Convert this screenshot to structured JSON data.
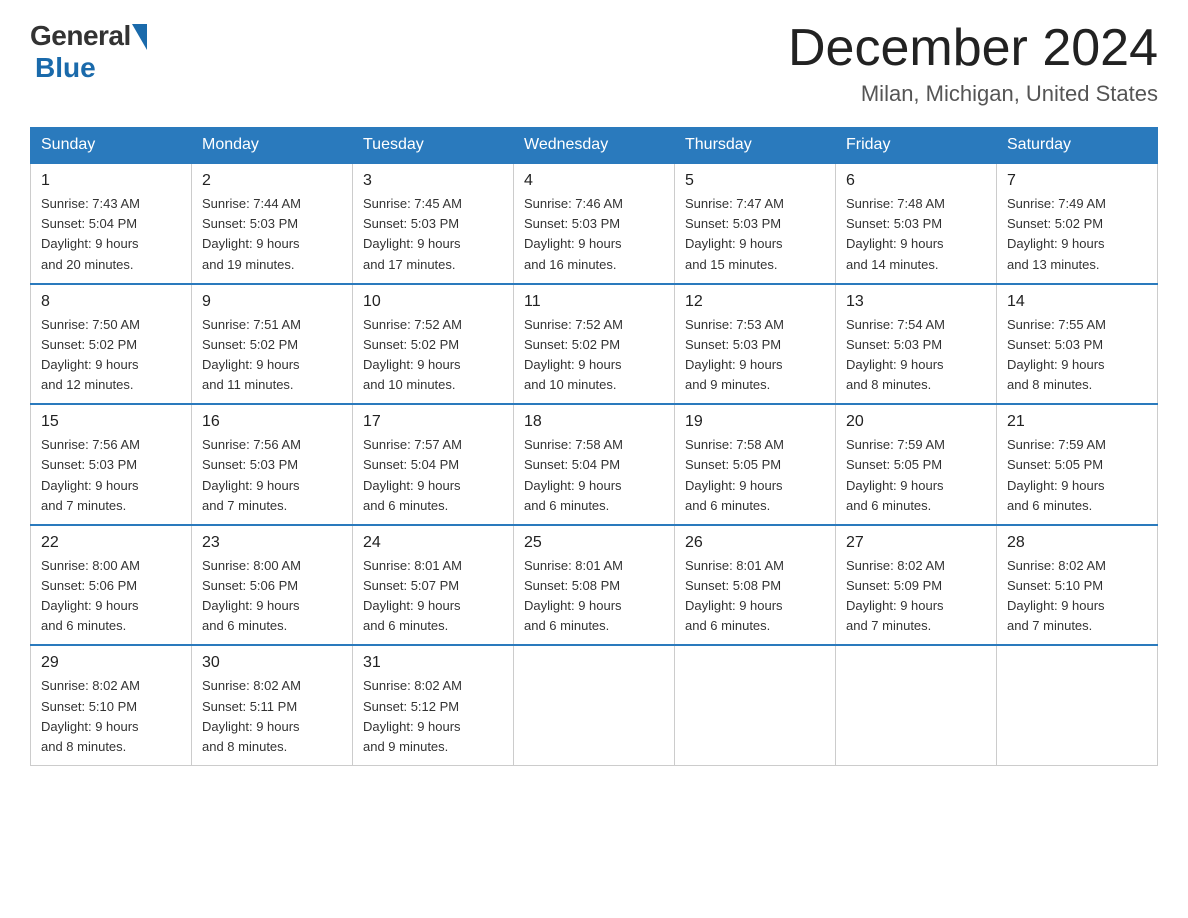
{
  "header": {
    "logo_general": "General",
    "logo_blue": "Blue",
    "title": "December 2024",
    "subtitle": "Milan, Michigan, United States"
  },
  "weekdays": [
    "Sunday",
    "Monday",
    "Tuesday",
    "Wednesday",
    "Thursday",
    "Friday",
    "Saturday"
  ],
  "weeks": [
    [
      {
        "day": "1",
        "sunrise": "7:43 AM",
        "sunset": "5:04 PM",
        "daylight": "9 hours and 20 minutes."
      },
      {
        "day": "2",
        "sunrise": "7:44 AM",
        "sunset": "5:03 PM",
        "daylight": "9 hours and 19 minutes."
      },
      {
        "day": "3",
        "sunrise": "7:45 AM",
        "sunset": "5:03 PM",
        "daylight": "9 hours and 17 minutes."
      },
      {
        "day": "4",
        "sunrise": "7:46 AM",
        "sunset": "5:03 PM",
        "daylight": "9 hours and 16 minutes."
      },
      {
        "day": "5",
        "sunrise": "7:47 AM",
        "sunset": "5:03 PM",
        "daylight": "9 hours and 15 minutes."
      },
      {
        "day": "6",
        "sunrise": "7:48 AM",
        "sunset": "5:03 PM",
        "daylight": "9 hours and 14 minutes."
      },
      {
        "day": "7",
        "sunrise": "7:49 AM",
        "sunset": "5:02 PM",
        "daylight": "9 hours and 13 minutes."
      }
    ],
    [
      {
        "day": "8",
        "sunrise": "7:50 AM",
        "sunset": "5:02 PM",
        "daylight": "9 hours and 12 minutes."
      },
      {
        "day": "9",
        "sunrise": "7:51 AM",
        "sunset": "5:02 PM",
        "daylight": "9 hours and 11 minutes."
      },
      {
        "day": "10",
        "sunrise": "7:52 AM",
        "sunset": "5:02 PM",
        "daylight": "9 hours and 10 minutes."
      },
      {
        "day": "11",
        "sunrise": "7:52 AM",
        "sunset": "5:02 PM",
        "daylight": "9 hours and 10 minutes."
      },
      {
        "day": "12",
        "sunrise": "7:53 AM",
        "sunset": "5:03 PM",
        "daylight": "9 hours and 9 minutes."
      },
      {
        "day": "13",
        "sunrise": "7:54 AM",
        "sunset": "5:03 PM",
        "daylight": "9 hours and 8 minutes."
      },
      {
        "day": "14",
        "sunrise": "7:55 AM",
        "sunset": "5:03 PM",
        "daylight": "9 hours and 8 minutes."
      }
    ],
    [
      {
        "day": "15",
        "sunrise": "7:56 AM",
        "sunset": "5:03 PM",
        "daylight": "9 hours and 7 minutes."
      },
      {
        "day": "16",
        "sunrise": "7:56 AM",
        "sunset": "5:03 PM",
        "daylight": "9 hours and 7 minutes."
      },
      {
        "day": "17",
        "sunrise": "7:57 AM",
        "sunset": "5:04 PM",
        "daylight": "9 hours and 6 minutes."
      },
      {
        "day": "18",
        "sunrise": "7:58 AM",
        "sunset": "5:04 PM",
        "daylight": "9 hours and 6 minutes."
      },
      {
        "day": "19",
        "sunrise": "7:58 AM",
        "sunset": "5:05 PM",
        "daylight": "9 hours and 6 minutes."
      },
      {
        "day": "20",
        "sunrise": "7:59 AM",
        "sunset": "5:05 PM",
        "daylight": "9 hours and 6 minutes."
      },
      {
        "day": "21",
        "sunrise": "7:59 AM",
        "sunset": "5:05 PM",
        "daylight": "9 hours and 6 minutes."
      }
    ],
    [
      {
        "day": "22",
        "sunrise": "8:00 AM",
        "sunset": "5:06 PM",
        "daylight": "9 hours and 6 minutes."
      },
      {
        "day": "23",
        "sunrise": "8:00 AM",
        "sunset": "5:06 PM",
        "daylight": "9 hours and 6 minutes."
      },
      {
        "day": "24",
        "sunrise": "8:01 AM",
        "sunset": "5:07 PM",
        "daylight": "9 hours and 6 minutes."
      },
      {
        "day": "25",
        "sunrise": "8:01 AM",
        "sunset": "5:08 PM",
        "daylight": "9 hours and 6 minutes."
      },
      {
        "day": "26",
        "sunrise": "8:01 AM",
        "sunset": "5:08 PM",
        "daylight": "9 hours and 6 minutes."
      },
      {
        "day": "27",
        "sunrise": "8:02 AM",
        "sunset": "5:09 PM",
        "daylight": "9 hours and 7 minutes."
      },
      {
        "day": "28",
        "sunrise": "8:02 AM",
        "sunset": "5:10 PM",
        "daylight": "9 hours and 7 minutes."
      }
    ],
    [
      {
        "day": "29",
        "sunrise": "8:02 AM",
        "sunset": "5:10 PM",
        "daylight": "9 hours and 8 minutes."
      },
      {
        "day": "30",
        "sunrise": "8:02 AM",
        "sunset": "5:11 PM",
        "daylight": "9 hours and 8 minutes."
      },
      {
        "day": "31",
        "sunrise": "8:02 AM",
        "sunset": "5:12 PM",
        "daylight": "9 hours and 9 minutes."
      },
      null,
      null,
      null,
      null
    ]
  ],
  "labels": {
    "sunrise_prefix": "Sunrise: ",
    "sunset_prefix": "Sunset: ",
    "daylight_prefix": "Daylight: "
  }
}
